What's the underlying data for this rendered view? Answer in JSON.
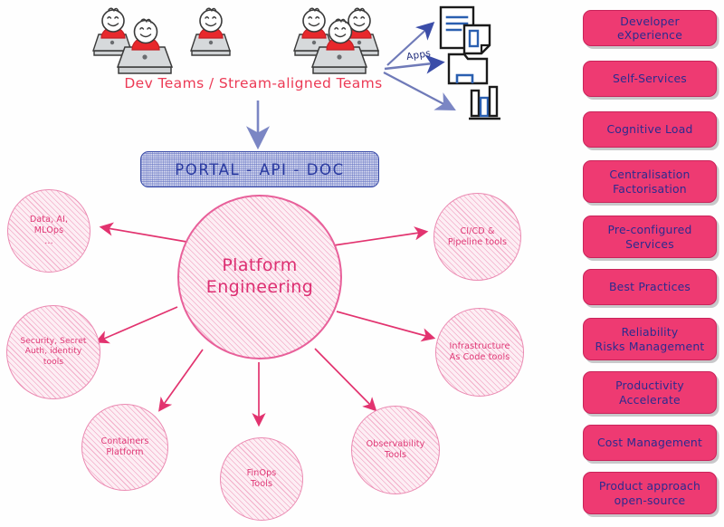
{
  "diagram": {
    "title_text": "Dev Teams / Stream-aligned Teams",
    "portal_label": "PORTAL - API - DOC",
    "apps_label": "Apps",
    "hub": {
      "line1": "Platform",
      "line2": "Engineering"
    },
    "satellites": [
      {
        "id": "data-ai-mlops",
        "lines": [
          "Data, AI,",
          "MLOps",
          "..."
        ]
      },
      {
        "id": "security",
        "lines": [
          "Security, Secret",
          "Auth, identity",
          "tools"
        ]
      },
      {
        "id": "containers",
        "lines": [
          "Containers",
          "Platform"
        ]
      },
      {
        "id": "finops",
        "lines": [
          "FinOps",
          "Tools"
        ]
      },
      {
        "id": "observability",
        "lines": [
          "Observability",
          "Tools"
        ]
      },
      {
        "id": "iac",
        "lines": [
          "Infrastructure",
          "As Code tools"
        ]
      },
      {
        "id": "cicd",
        "lines": [
          "CI/CD &",
          "Pipeline tools"
        ]
      }
    ],
    "output_icons": [
      {
        "id": "document-icon",
        "label": "document"
      },
      {
        "id": "folder-icon",
        "label": "folder"
      },
      {
        "id": "bar-chart-icon",
        "label": "bar-chart"
      }
    ],
    "team_groups": 2,
    "people_per_group": 3
  },
  "benefits": {
    "items": [
      {
        "lines": [
          "Developer eXperience"
        ]
      },
      {
        "lines": [
          "Self-Services"
        ]
      },
      {
        "lines": [
          "Cognitive Load"
        ]
      },
      {
        "lines": [
          "Centralisation",
          "Factorisation"
        ]
      },
      {
        "lines": [
          "Pre-configured",
          "Services"
        ]
      },
      {
        "lines": [
          "Best Practices"
        ]
      },
      {
        "lines": [
          "Reliability",
          "Risks Management"
        ]
      },
      {
        "lines": [
          "Productivity",
          "Accelerate"
        ]
      },
      {
        "lines": [
          "Cost Management"
        ]
      },
      {
        "lines": [
          "Product approach",
          "open-source"
        ]
      }
    ]
  },
  "colors": {
    "badge_fill": "#ee3a72",
    "badge_text": "#2b2b8f",
    "accent_pink": "#e03a77",
    "navy": "#2a3aa0",
    "crimson": "#ec3a55",
    "person_shirt": "#e8282c",
    "laptop_gray": "#c9cbcd"
  }
}
